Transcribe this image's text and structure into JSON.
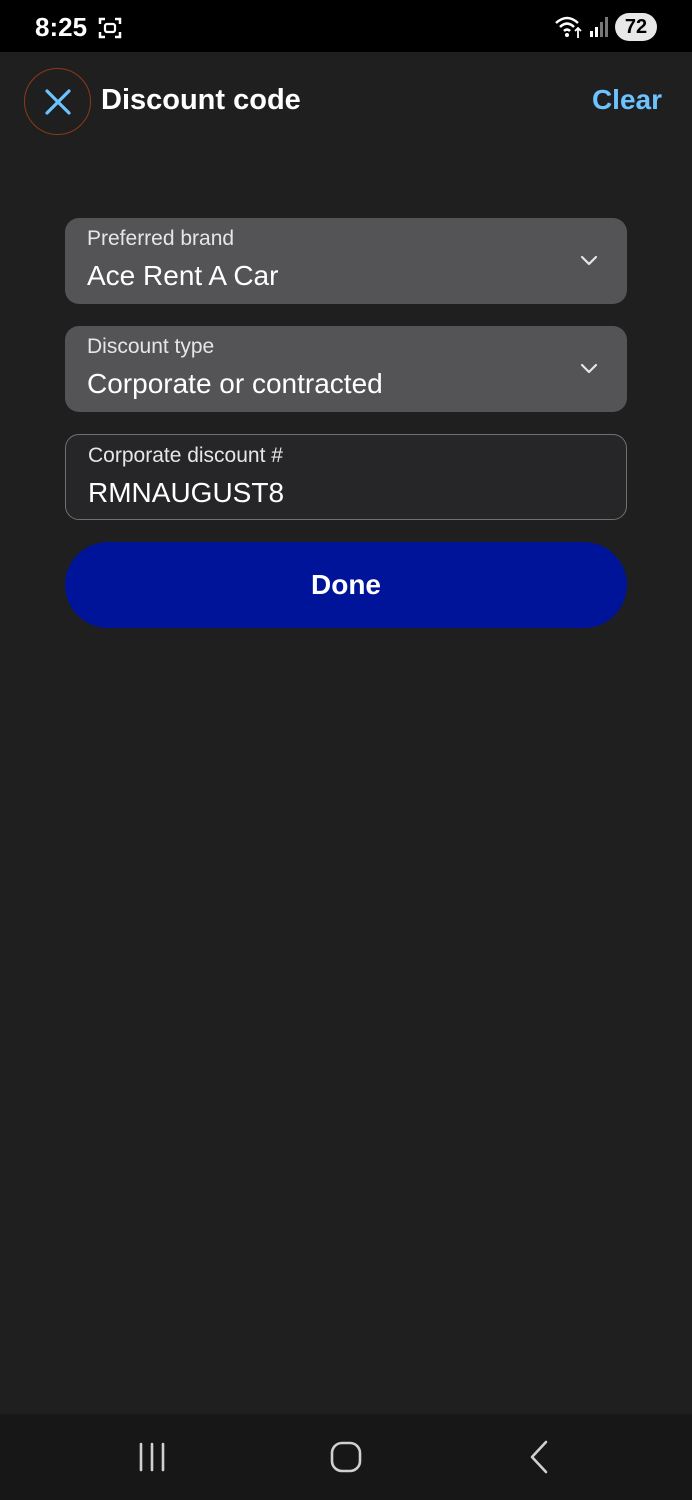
{
  "status_bar": {
    "time": "8:25",
    "battery": "72",
    "icons": [
      "screenshot-icon",
      "wifi-icon",
      "signal-icon"
    ]
  },
  "header": {
    "title": "Discount code",
    "clear_label": "Clear",
    "close_icon": "close-icon"
  },
  "form": {
    "brand": {
      "label": "Preferred brand",
      "value": "Ace Rent A Car"
    },
    "discount_type": {
      "label": "Discount type",
      "value": "Corporate or contracted"
    },
    "corporate_discount": {
      "label": "Corporate discount #",
      "value": "RMNAUGUST8"
    }
  },
  "done_label": "Done",
  "nav": {
    "icons": [
      "recent-apps-icon",
      "home-icon",
      "back-icon"
    ]
  },
  "colors": {
    "background": "#1f1f20",
    "accent_link": "#6cc3ff",
    "primary_button": "#00149a",
    "select_bg": "#545456"
  }
}
